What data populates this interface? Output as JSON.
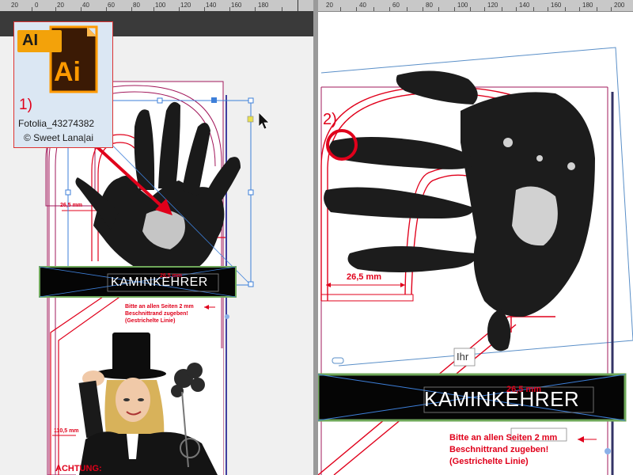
{
  "file_tile": {
    "icon_text": "Ai",
    "tab_text": "AI",
    "step": "1)",
    "filename": "Fotolia_43274382",
    "credit": "© Sweet Lana|ai"
  },
  "left_ruler": [
    "20",
    "0",
    "20",
    "40",
    "60",
    "80",
    "100",
    "120",
    "140",
    "160",
    "180"
  ],
  "right_ruler": [
    "20",
    "40",
    "60",
    "80",
    "100",
    "120",
    "140",
    "160",
    "180",
    "200"
  ],
  "left_doc": {
    "dim_top": "26,5 mm",
    "dim_bottom": "110,5 mm",
    "banner_text": "KAMINKEHRER",
    "banner_overlay": "26,5 mm",
    "note_line1": "Bitte an allen Seiten 2 mm",
    "note_line2": "Beschnittrand zugeben!",
    "note_line3": "(Gestrichelte Linie)",
    "achtung": "ACHTUNG:"
  },
  "right_doc": {
    "step": "2)",
    "dim_label": "26,5 mm",
    "ihr_label": "Ihr",
    "banner_text": "KAMINKEHRER",
    "banner_overlay": "26,5 mm",
    "note_line1": "Bitte an allen Seiten 2 mm",
    "note_line2": "Beschnittrand zugeben!",
    "note_line3": "(Gestrichelte Linie)"
  },
  "colors": {
    "red": "#e0001b",
    "magenta": "#a2185b",
    "selection": "#3d7fd9",
    "banner": "#050505",
    "frame_green": "#6fa85a"
  }
}
